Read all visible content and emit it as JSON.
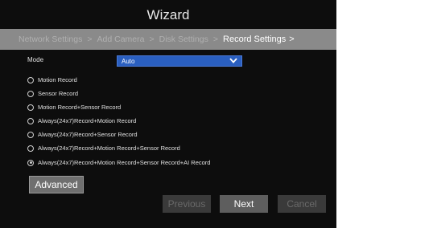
{
  "window": {
    "title": "Wizard"
  },
  "steps": {
    "items": [
      "Network Settings",
      "Add Camera",
      "Disk Settings",
      "Record Settings"
    ],
    "separator": ">",
    "trailing": ">",
    "active_index": 3
  },
  "mode": {
    "label": "Mode",
    "value": "Auto",
    "icon": "chevron-down-icon"
  },
  "options": [
    {
      "label": "Motion Record",
      "checked": false
    },
    {
      "label": "Sensor Record",
      "checked": false
    },
    {
      "label": "Motion Record+Sensor Record",
      "checked": false
    },
    {
      "label": "Always(24x7)Record+Motion Record",
      "checked": false
    },
    {
      "label": "Always(24x7)Record+Sensor Record",
      "checked": false
    },
    {
      "label": "Always(24x7)Record+Motion  Record+Sensor Record",
      "checked": false
    },
    {
      "label": "Always(24x7)Record+Motion  Record+Sensor Record+AI  Record",
      "checked": true
    }
  ],
  "buttons": {
    "advanced": "Advanced",
    "previous": "Previous",
    "next": "Next",
    "cancel": "Cancel"
  },
  "colors": {
    "background": "#0d0d0d",
    "step_bar": "#8a8a8a",
    "select": "#2a5fc0"
  }
}
